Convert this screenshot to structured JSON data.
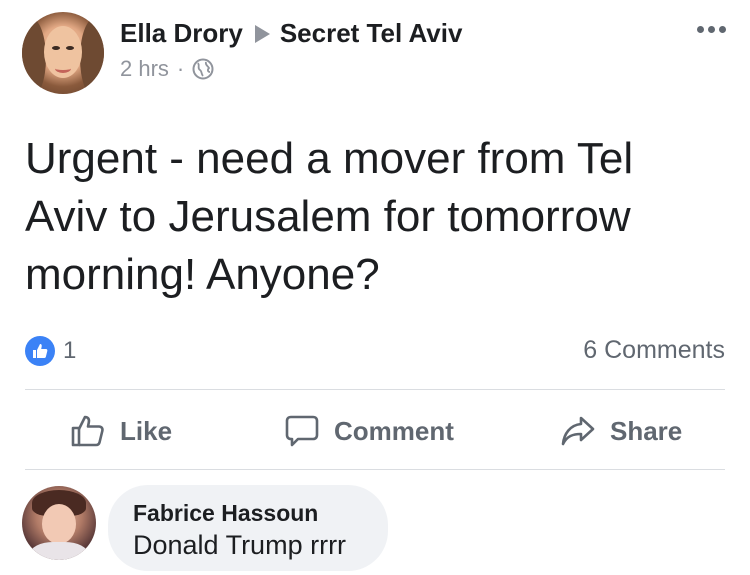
{
  "post": {
    "author": "Ella Drory",
    "group": "Secret Tel Aviv",
    "time": "2 hrs",
    "separator": "·",
    "privacy_icon": "globe-icon",
    "text": "Urgent - need a mover from Tel Aviv to Jerusalem for tomorrow morning! Anyone?"
  },
  "reactions": {
    "like_count": "1",
    "comments_count": "6 Comments",
    "accent": "#3b82f6"
  },
  "actions": {
    "like": "Like",
    "comment": "Comment",
    "share": "Share"
  },
  "comment": {
    "author": "Fabrice Hassoun",
    "text": "Donald Trump rrrr"
  }
}
